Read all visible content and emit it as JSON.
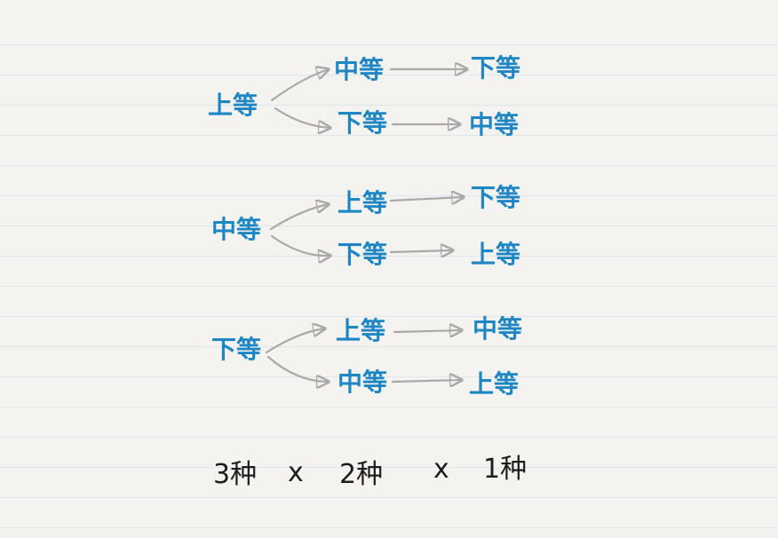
{
  "tree": [
    {
      "root": "上等",
      "branches": [
        {
          "second": "中等",
          "third": "下等"
        },
        {
          "second": "下等",
          "third": "中等"
        }
      ]
    },
    {
      "root": "中等",
      "branches": [
        {
          "second": "上等",
          "third": "下等"
        },
        {
          "second": "下等",
          "third": "上等"
        }
      ]
    },
    {
      "root": "下等",
      "branches": [
        {
          "second": "上等",
          "third": "中等"
        },
        {
          "second": "中等",
          "third": "上等"
        }
      ]
    }
  ],
  "formula": {
    "term1": "3种",
    "op1": "x",
    "term2": "2种",
    "op2": "x",
    "term3": "1种"
  },
  "colors": {
    "node_text": "#1f86c4",
    "arrow": "#a9a9a9",
    "formula_text": "#1d1d1d",
    "rule_line": "#dfe6ee",
    "paper": "#f4f3ef"
  }
}
